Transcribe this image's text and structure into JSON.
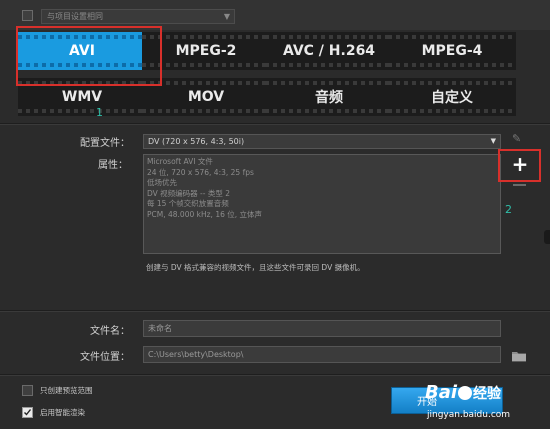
{
  "top": {
    "profile_combo": "与项目设置相同"
  },
  "formats": {
    "row1": [
      "AVI",
      "MPEG-2",
      "AVC / H.264",
      "MPEG-4"
    ],
    "row2": [
      "WMV",
      "MOV",
      "音频",
      "自定义"
    ],
    "selected": "AVI",
    "annotation_1": "1"
  },
  "settings": {
    "profile_label": "配置文件：",
    "profile_value": "DV (720 x 576, 4:3, 50i)",
    "properties_label": "属性：",
    "properties_lines": [
      "Microsoft AVI 文件",
      "24 位, 720 x 576, 4:3, 25 fps",
      "低场优先",
      "DV 视频编码器 -- 类型 2",
      "每 15 个帧交织放置音频",
      "PCM, 48.000 kHz, 16 位, 立体声"
    ],
    "description": "创建与 DV 格式兼容的视频文件，且这些文件可录回 DV 摄像机。",
    "annotation_2": "2",
    "add_icon": "plus-icon",
    "edit_icon": "pencil-icon",
    "remove_icon": "minus-icon"
  },
  "output": {
    "filename_label": "文件名：",
    "filename_value": "未命名",
    "location_label": "文件位置：",
    "location_value": "C:\\Users\\betty\\Desktop\\",
    "folder_icon": "folder-icon"
  },
  "bottom": {
    "option1": "只创建预览范围",
    "option1_checked": false,
    "option2": "启用智能渲染",
    "option2_checked": true,
    "start_button": "开始"
  },
  "watermark": {
    "brand": "Bai",
    "brand2": "经验",
    "site": "jingyan.baidu.com"
  },
  "colors": {
    "selected_tile": "#1a9be0",
    "annotation_box": "#d8302b",
    "annotation_text": "#2fbfa9"
  }
}
